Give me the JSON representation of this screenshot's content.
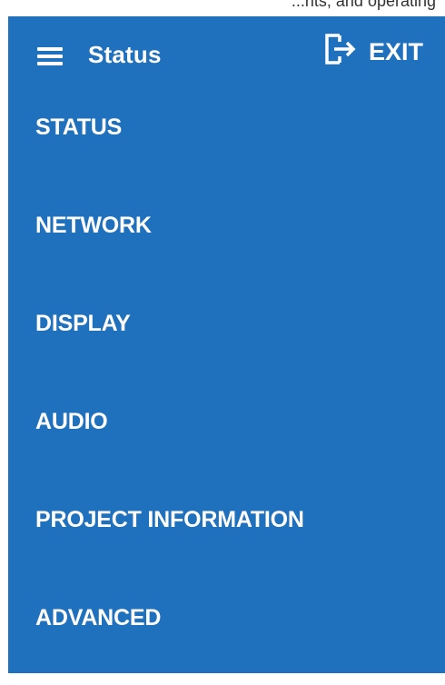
{
  "top_strip": {
    "text": "...nts, and operating"
  },
  "header": {
    "menu_icon": "hamburger-icon",
    "title": "Status",
    "exit_icon": "exit-icon",
    "exit_label": "EXIT"
  },
  "menu": {
    "items": [
      {
        "label": "STATUS"
      },
      {
        "label": "NETWORK"
      },
      {
        "label": "DISPLAY"
      },
      {
        "label": "AUDIO"
      },
      {
        "label": "PROJECT INFORMATION"
      },
      {
        "label": "ADVANCED"
      }
    ]
  },
  "colors": {
    "panel_background": "#1f70bd",
    "text": "#ffffff"
  }
}
